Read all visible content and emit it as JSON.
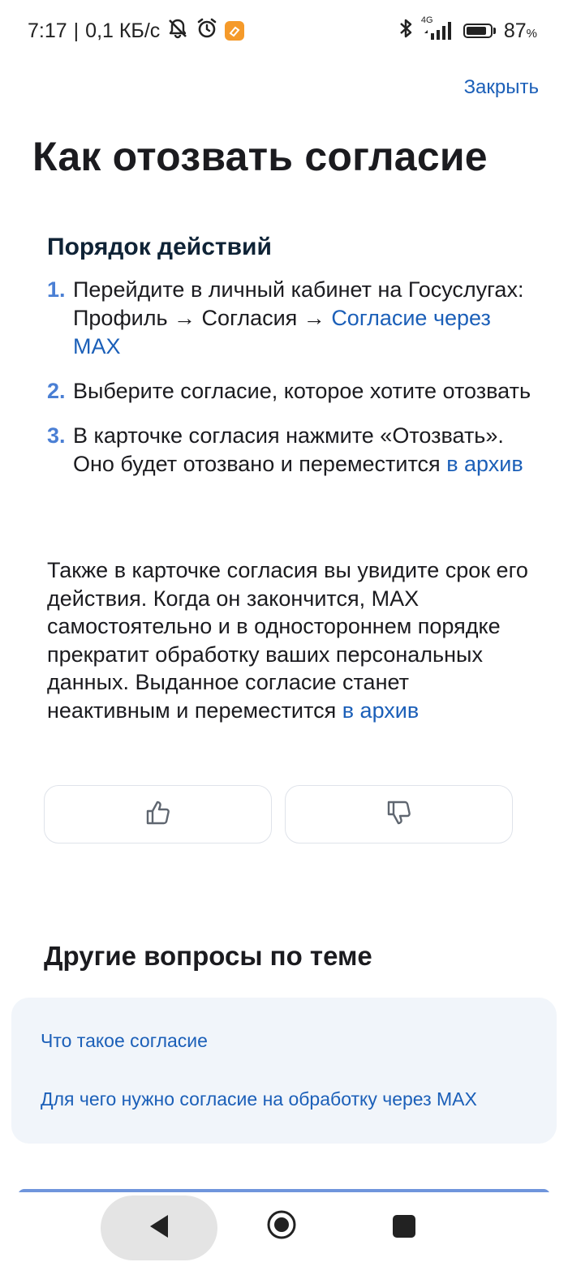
{
  "status_bar": {
    "time": "7:17",
    "separator": "|",
    "speed": "0,1 КБ/с",
    "network_type": "4G",
    "battery_percent": "87",
    "battery_unit": "%",
    "battery_level": 0.87,
    "icons": [
      "mute-icon",
      "alarm-icon",
      "app-notification-icon",
      "bluetooth-icon",
      "signal-icon",
      "battery-icon"
    ]
  },
  "header": {
    "close_label": "Закрыть"
  },
  "page": {
    "title": "Как отозвать согласие",
    "section_title": "Порядок действий",
    "steps": [
      {
        "number": "1.",
        "text": "Перейдите в личный кабинет на Госуслугах: Профиль → Согласия → ",
        "link": "Согласие через MAX"
      },
      {
        "number": "2.",
        "text": "Выберите согласие, которое хотите отозвать"
      },
      {
        "number": "3.",
        "text": "В карточке согласия нажмите «Отозвать». Оно будет отозвано и переместится ",
        "link": "в архив"
      }
    ],
    "paragraph_text": "Также в карточке согласия вы увидите срок его действия. Когда он закончится, MAX самостоятельно и в одностороннем порядке прекратит обработку ваших персональных данных. Выданное согласие станет неактивным и переместится ",
    "paragraph_link": "в архив"
  },
  "feedback": {
    "like_icon": "thumbs-up-icon",
    "dislike_icon": "thumbs-down-icon"
  },
  "related": {
    "title": "Другие вопросы по теме",
    "links": [
      "Что такое согласие",
      "Для чего нужно согласие на обработку через MAX"
    ]
  },
  "nav": {
    "icons": [
      "back-icon",
      "home-icon",
      "recent-apps-icon"
    ]
  },
  "colors": {
    "link": "#1b5fb8",
    "step_number": "#4a7fd4",
    "card_background": "#f1f5fa"
  }
}
